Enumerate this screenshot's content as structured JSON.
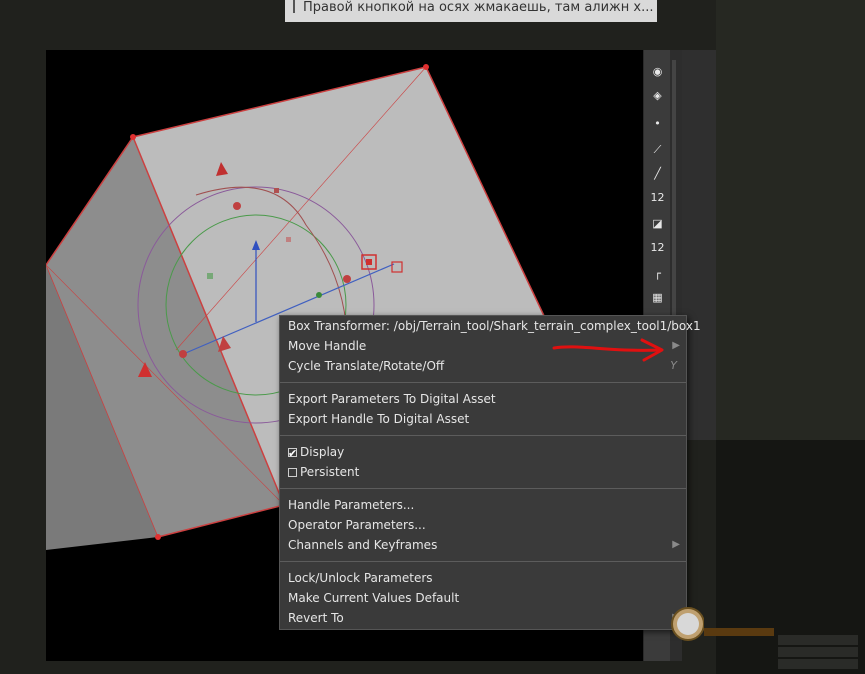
{
  "chat_banner": {
    "text": "Правой кнопкой на осях жмакаешь, там алижн х..."
  },
  "context_menu": {
    "groups": [
      [
        {
          "label": "Box Transformer: /obj/Terrain_tool/Shark_terrain_complex_tool1/box1"
        },
        {
          "label": "Move Handle",
          "submenu": true
        },
        {
          "label": "Cycle Translate/Rotate/Off",
          "shortcut": "Y"
        }
      ],
      [
        {
          "label": "Export Parameters To Digital Asset"
        },
        {
          "label": "Export Handle To Digital Asset"
        }
      ],
      [
        {
          "label": "Display",
          "checkbox": true,
          "checked": true
        },
        {
          "label": "Persistent",
          "checkbox": true,
          "checked": false
        }
      ],
      [
        {
          "label": "Handle Parameters..."
        },
        {
          "label": "Operator Parameters..."
        },
        {
          "label": "Channels and Keyframes",
          "submenu": true
        }
      ],
      [
        {
          "label": "Lock/Unlock Parameters"
        },
        {
          "label": "Make Current Values Default"
        },
        {
          "label": "Revert To",
          "submenu": true
        }
      ]
    ]
  },
  "toolbar": {
    "icons": [
      "select-icon",
      "view-icon",
      "display-icon",
      "point-icon",
      "brush-icon",
      "pin-icon",
      "number-12-icon",
      "paint-icon",
      "label-12-icon",
      "corner-icon",
      "grid-icon"
    ],
    "labels": {
      "number": "12",
      "label": "12"
    }
  },
  "annotation": {
    "color": "#e01010"
  },
  "colors": {
    "menu_bg": "#3a3a3a",
    "menu_text": "#e6e6e6",
    "box_face": "#b9b9b9",
    "edge_red": "#d03030"
  }
}
